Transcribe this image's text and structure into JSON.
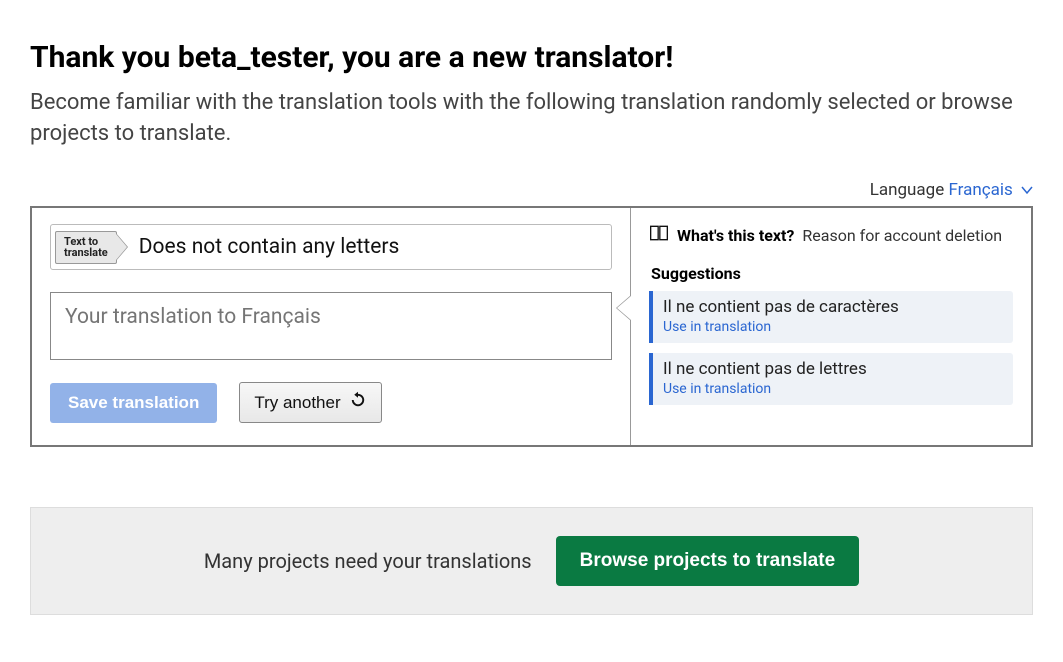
{
  "header": {
    "title": "Thank you beta_tester, you are a new translator!",
    "subtitle": "Become familiar with the translation tools with the following translation randomly selected or browse projects to translate."
  },
  "language_picker": {
    "label": "Language",
    "current": "Français"
  },
  "translation": {
    "src_label_l1": "Text to",
    "src_label_l2": "translate",
    "src_text": "Does not contain any letters",
    "input_placeholder": "Your translation to Français",
    "save_label": "Save translation",
    "try_label": "Try another"
  },
  "context": {
    "whats_label": "What's this text?",
    "whats_value": "Reason for account deletion"
  },
  "suggestions": {
    "title": "Suggestions",
    "use_label": "Use in translation",
    "items": [
      {
        "text": "Il ne contient pas de caractères"
      },
      {
        "text": "Il ne contient pas de lettres"
      }
    ]
  },
  "bottom": {
    "text": "Many projects need your translations",
    "browse_label": "Browse projects to translate"
  }
}
